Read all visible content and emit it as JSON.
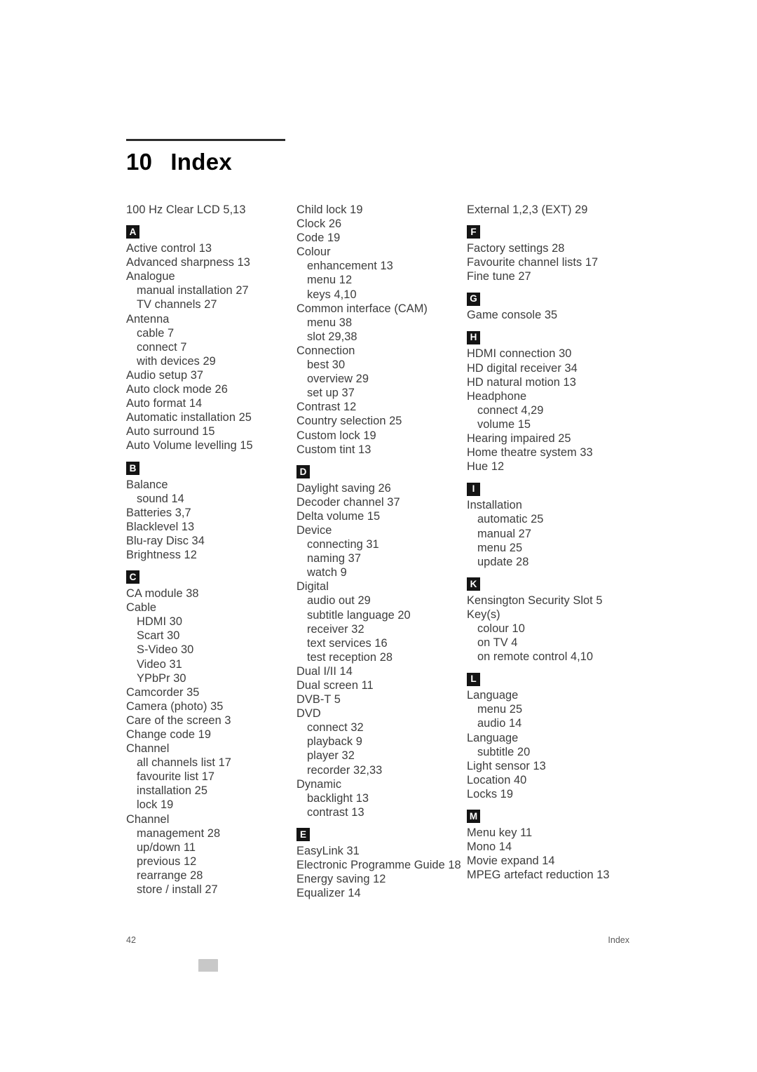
{
  "heading": {
    "number": "10",
    "title": "Index"
  },
  "footer": {
    "page_number": "42",
    "section_label": "Index"
  },
  "columns": [
    {
      "groups": [
        {
          "letter": null,
          "entries": [
            {
              "text": "100 Hz Clear LCD  5,13",
              "sub": false
            }
          ]
        },
        {
          "letter": "A",
          "entries": [
            {
              "text": "Active control  13",
              "sub": false
            },
            {
              "text": "Advanced sharpness  13",
              "sub": false
            },
            {
              "text": "Analogue",
              "sub": false
            },
            {
              "text": "manual installation  27",
              "sub": true
            },
            {
              "text": "TV channels  27",
              "sub": true
            },
            {
              "text": "Antenna",
              "sub": false
            },
            {
              "text": "cable  7",
              "sub": true
            },
            {
              "text": "connect  7",
              "sub": true
            },
            {
              "text": "with devices  29",
              "sub": true
            },
            {
              "text": "Audio setup  37",
              "sub": false
            },
            {
              "text": "Auto clock mode  26",
              "sub": false
            },
            {
              "text": "Auto format  14",
              "sub": false
            },
            {
              "text": "Automatic installation  25",
              "sub": false
            },
            {
              "text": "Auto surround  15",
              "sub": false
            },
            {
              "text": "Auto Volume levelling  15",
              "sub": false
            }
          ]
        },
        {
          "letter": "B",
          "entries": [
            {
              "text": "Balance",
              "sub": false
            },
            {
              "text": "sound  14",
              "sub": true
            },
            {
              "text": "Batteries  3,7",
              "sub": false
            },
            {
              "text": "Blacklevel  13",
              "sub": false
            },
            {
              "text": "Blu-ray Disc  34",
              "sub": false
            },
            {
              "text": "Brightness  12",
              "sub": false
            }
          ]
        },
        {
          "letter": "C",
          "entries": [
            {
              "text": "CA module  38",
              "sub": false
            },
            {
              "text": "Cable",
              "sub": false
            },
            {
              "text": "HDMI  30",
              "sub": true
            },
            {
              "text": "Scart  30",
              "sub": true
            },
            {
              "text": "S-Video  30",
              "sub": true
            },
            {
              "text": "Video  31",
              "sub": true
            },
            {
              "text": "YPbPr  30",
              "sub": true
            },
            {
              "text": "Camcorder  35",
              "sub": false
            },
            {
              "text": "Camera (photo)  35",
              "sub": false
            },
            {
              "text": "Care of the screen  3",
              "sub": false
            },
            {
              "text": "Change code  19",
              "sub": false
            },
            {
              "text": "Channel",
              "sub": false
            },
            {
              "text": "all channels list  17",
              "sub": true
            },
            {
              "text": "favourite list  17",
              "sub": true
            },
            {
              "text": "installation  25",
              "sub": true
            },
            {
              "text": "lock  19",
              "sub": true
            },
            {
              "text": "Channel",
              "sub": false
            },
            {
              "text": "management  28",
              "sub": true
            },
            {
              "text": "up/down  11",
              "sub": true
            },
            {
              "text": "previous  12",
              "sub": true
            },
            {
              "text": "rearrange  28",
              "sub": true
            },
            {
              "text": "store / install  27",
              "sub": true
            }
          ]
        }
      ]
    },
    {
      "groups": [
        {
          "letter": null,
          "entries": [
            {
              "text": "Child lock  19",
              "sub": false
            },
            {
              "text": "Clock  26",
              "sub": false
            },
            {
              "text": "Code  19",
              "sub": false
            },
            {
              "text": "Colour",
              "sub": false
            },
            {
              "text": "enhancement  13",
              "sub": true
            },
            {
              "text": "menu  12",
              "sub": true
            },
            {
              "text": "keys  4,10",
              "sub": true
            },
            {
              "text": "Common interface (CAM)",
              "sub": false
            },
            {
              "text": "menu  38",
              "sub": true
            },
            {
              "text": "slot  29,38",
              "sub": true
            },
            {
              "text": "Connection",
              "sub": false
            },
            {
              "text": "best  30",
              "sub": true
            },
            {
              "text": "overview  29",
              "sub": true
            },
            {
              "text": "set up  37",
              "sub": true
            },
            {
              "text": "Contrast  12",
              "sub": false
            },
            {
              "text": "Country selection  25",
              "sub": false
            },
            {
              "text": "Custom lock  19",
              "sub": false
            },
            {
              "text": "Custom tint  13",
              "sub": false
            }
          ]
        },
        {
          "letter": "D",
          "entries": [
            {
              "text": "Daylight saving  26",
              "sub": false
            },
            {
              "text": "Decoder channel  37",
              "sub": false
            },
            {
              "text": "Delta volume  15",
              "sub": false
            },
            {
              "text": "Device",
              "sub": false
            },
            {
              "text": "connecting  31",
              "sub": true
            },
            {
              "text": "naming  37",
              "sub": true
            },
            {
              "text": "watch  9",
              "sub": true
            },
            {
              "text": "Digital",
              "sub": false
            },
            {
              "text": "audio out  29",
              "sub": true
            },
            {
              "text": "subtitle language  20",
              "sub": true
            },
            {
              "text": "receiver  32",
              "sub": true
            },
            {
              "text": "text services  16",
              "sub": true
            },
            {
              "text": "test reception  28",
              "sub": true
            },
            {
              "text": "Dual I/II  14",
              "sub": false
            },
            {
              "text": "Dual screen  11",
              "sub": false
            },
            {
              "text": "DVB-T  5",
              "sub": false
            },
            {
              "text": "DVD",
              "sub": false
            },
            {
              "text": "connect  32",
              "sub": true
            },
            {
              "text": "playback  9",
              "sub": true
            },
            {
              "text": "player  32",
              "sub": true
            },
            {
              "text": "recorder  32,33",
              "sub": true
            },
            {
              "text": "Dynamic",
              "sub": false
            },
            {
              "text": "backlight  13",
              "sub": true
            },
            {
              "text": "contrast  13",
              "sub": true
            }
          ]
        },
        {
          "letter": "E",
          "entries": [
            {
              "text": "EasyLink  31",
              "sub": false
            },
            {
              "text": "Electronic Programme Guide  18",
              "sub": false
            },
            {
              "text": "Energy saving  12",
              "sub": false
            },
            {
              "text": "Equalizer  14",
              "sub": false
            }
          ]
        }
      ]
    },
    {
      "groups": [
        {
          "letter": null,
          "entries": [
            {
              "text": "External 1,2,3 (EXT)  29",
              "sub": false
            }
          ]
        },
        {
          "letter": "F",
          "entries": [
            {
              "text": "Factory settings  28",
              "sub": false
            },
            {
              "text": "Favourite channel lists  17",
              "sub": false
            },
            {
              "text": "Fine tune  27",
              "sub": false
            }
          ]
        },
        {
          "letter": "G",
          "entries": [
            {
              "text": "Game console  35",
              "sub": false
            }
          ]
        },
        {
          "letter": "H",
          "entries": [
            {
              "text": "HDMI connection  30",
              "sub": false
            },
            {
              "text": "HD digital receiver  34",
              "sub": false
            },
            {
              "text": "HD natural motion  13",
              "sub": false
            },
            {
              "text": "Headphone",
              "sub": false
            },
            {
              "text": "connect  4,29",
              "sub": true
            },
            {
              "text": "volume  15",
              "sub": true
            },
            {
              "text": "Hearing impaired  25",
              "sub": false
            },
            {
              "text": "Home theatre system  33",
              "sub": false
            },
            {
              "text": "Hue  12",
              "sub": false
            }
          ]
        },
        {
          "letter": "I",
          "entries": [
            {
              "text": "Installation",
              "sub": false
            },
            {
              "text": "automatic  25",
              "sub": true
            },
            {
              "text": "manual  27",
              "sub": true
            },
            {
              "text": "menu  25",
              "sub": true
            },
            {
              "text": "update  28",
              "sub": true
            }
          ]
        },
        {
          "letter": "K",
          "entries": [
            {
              "text": "Kensington Security Slot  5",
              "sub": false
            },
            {
              "text": "Key(s)",
              "sub": false
            },
            {
              "text": "colour  10",
              "sub": true
            },
            {
              "text": "on TV  4",
              "sub": true
            },
            {
              "text": "on remote control  4,10",
              "sub": true
            }
          ]
        },
        {
          "letter": "L",
          "entries": [
            {
              "text": "Language",
              "sub": false
            },
            {
              "text": "menu  25",
              "sub": true
            },
            {
              "text": "audio  14",
              "sub": true
            },
            {
              "text": "Language",
              "sub": false
            },
            {
              "text": "subtitle  20",
              "sub": true
            },
            {
              "text": "Light sensor  13",
              "sub": false
            },
            {
              "text": "Location  40",
              "sub": false
            },
            {
              "text": "Locks  19",
              "sub": false
            }
          ]
        },
        {
          "letter": "M",
          "entries": [
            {
              "text": "Menu key  11",
              "sub": false
            },
            {
              "text": "Mono  14",
              "sub": false
            },
            {
              "text": "Movie expand  14",
              "sub": false
            },
            {
              "text": "MPEG artefact reduction  13",
              "sub": false
            }
          ]
        }
      ]
    }
  ]
}
